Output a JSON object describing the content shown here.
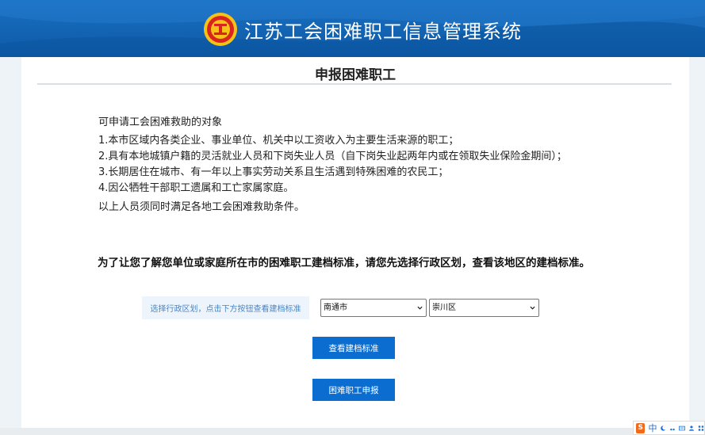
{
  "header": {
    "title": "江苏工会困难职工信息管理系统",
    "logo_icon": "union-emblem-icon",
    "brand_color": "#1467b8"
  },
  "page": {
    "title": "申报困难职工"
  },
  "eligibility": {
    "heading": "可申请工会困难救助的对象",
    "items": [
      "1.本市区域内各类企业、事业单位、机关中以工资收入为主要生活来源的职工；",
      "2.具有本地城镇户籍的灵活就业人员和下岗失业人员（自下岗失业起两年内或在领取失业保险金期间）；",
      "3.长期居住在城市、有一年以上事实劳动关系且生活遇到特殊困难的农民工；",
      "4.因公牺牲干部职工遗属和工亡家属家庭。"
    ],
    "note": "以上人员须同时满足各地工会困难救助条件。"
  },
  "instruction": "为了让您了解您单位或家庭所在市的困难职工建档标准，请您先选择行政区划，查看该地区的建档标准。",
  "region": {
    "label": "选择行政区划，点击下方按钮查看建档标准",
    "city_value": "南通市",
    "district_value": "崇川区"
  },
  "buttons": {
    "view_label": "查看建档标准",
    "apply_label": "困难职工申报",
    "color": "#0c6dd0"
  },
  "ime": {
    "mode": "中",
    "logo_icon": "sogou-icon"
  }
}
